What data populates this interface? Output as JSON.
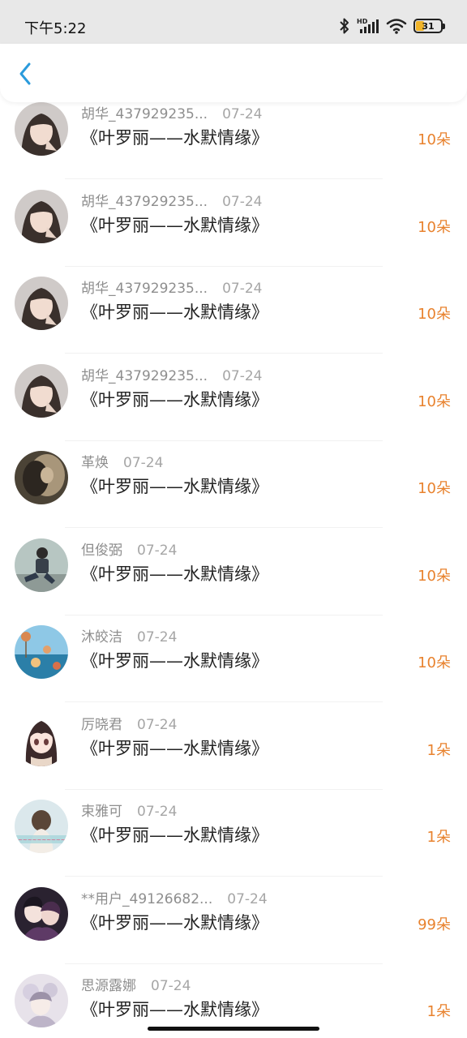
{
  "status_bar": {
    "time": "下午5:22",
    "battery_level": "31",
    "battery_fraction": 0.31
  },
  "nav": {
    "back_icon": "chevron-left-icon",
    "accent": "#2a9bdc"
  },
  "colors": {
    "amount": "#e8822e",
    "battery": "#f0b429"
  },
  "records": [
    {
      "name": "胡华_437929235...",
      "date": "07-24",
      "title": "《叶罗丽——水默情缘》",
      "amount": "10朵",
      "avatar": "avatar-woman-portrait"
    },
    {
      "name": "胡华_437929235...",
      "date": "07-24",
      "title": "《叶罗丽——水默情缘》",
      "amount": "10朵",
      "avatar": "avatar-woman-portrait"
    },
    {
      "name": "胡华_437929235...",
      "date": "07-24",
      "title": "《叶罗丽——水默情缘》",
      "amount": "10朵",
      "avatar": "avatar-woman-portrait"
    },
    {
      "name": "胡华_437929235...",
      "date": "07-24",
      "title": "《叶罗丽——水默情缘》",
      "amount": "10朵",
      "avatar": "avatar-woman-portrait"
    },
    {
      "name": "革焕",
      "date": "07-24",
      "title": "《叶罗丽——水默情缘》",
      "amount": "10朵",
      "avatar": "avatar-dark-photo"
    },
    {
      "name": "但俊弼",
      "date": "07-24",
      "title": "《叶罗丽——水默情缘》",
      "amount": "10朵",
      "avatar": "avatar-man-sitting"
    },
    {
      "name": "沐皎洁",
      "date": "07-24",
      "title": "《叶罗丽——水默情缘》",
      "amount": "10朵",
      "avatar": "avatar-seaside"
    },
    {
      "name": "厉晓君",
      "date": "07-24",
      "title": "《叶罗丽——水默情缘》",
      "amount": "1朵",
      "avatar": "avatar-anime-girl"
    },
    {
      "name": "束雅可",
      "date": "07-24",
      "title": "《叶罗丽——水默情缘》",
      "amount": "1朵",
      "avatar": "avatar-girl-back"
    },
    {
      "name": "**用户_49126682...",
      "date": "07-24",
      "title": "《叶罗丽——水默情缘》",
      "amount": "99朵",
      "avatar": "avatar-anime-couple"
    },
    {
      "name": "思源露娜",
      "date": "07-24",
      "title": "《叶罗丽——水默情缘》",
      "amount": "1朵",
      "avatar": "avatar-anime-pastel"
    }
  ]
}
